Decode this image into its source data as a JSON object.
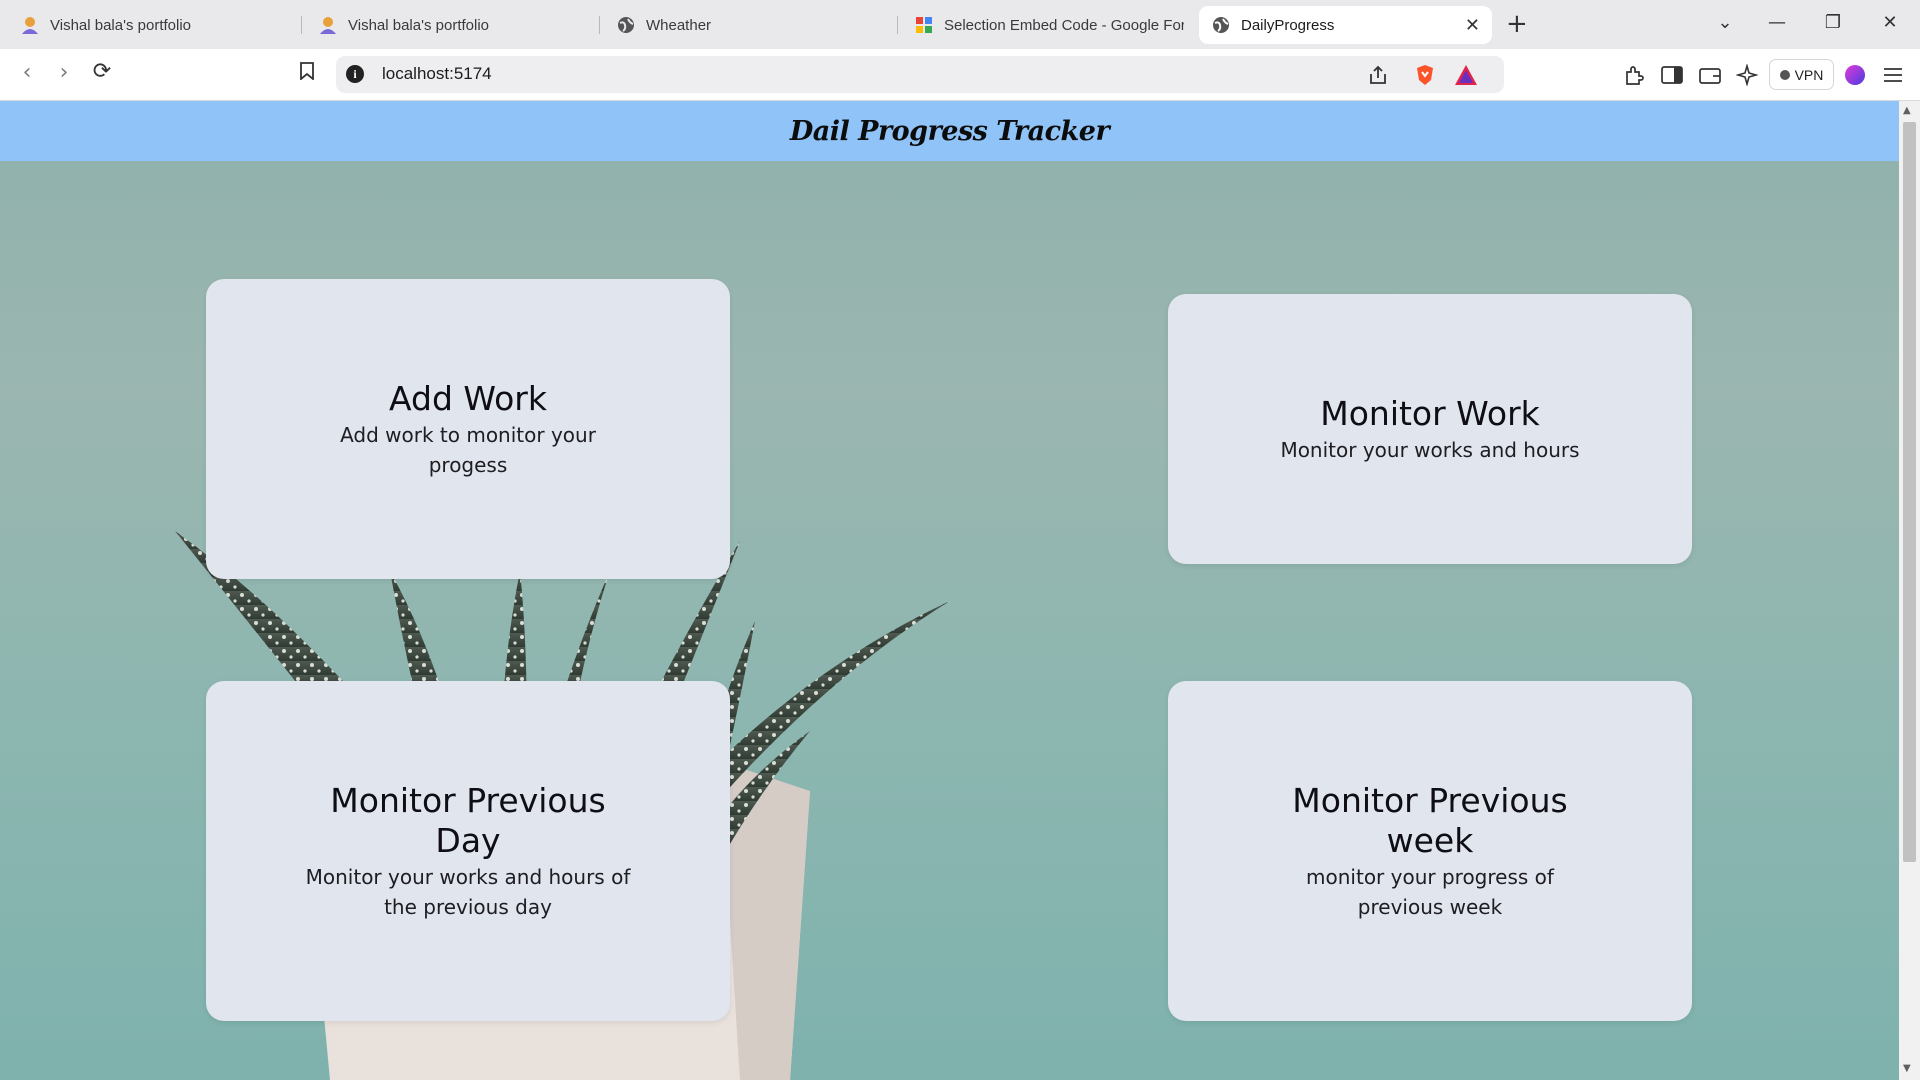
{
  "browser": {
    "tabs": [
      {
        "title": "Vishal bala's portfolio",
        "icon": "avatar-icon"
      },
      {
        "title": "Vishal bala's portfolio",
        "icon": "avatar-icon"
      },
      {
        "title": "Wheather",
        "icon": "globe-icon"
      },
      {
        "title": "Selection Embed Code - Google For",
        "icon": "google-forms-icon"
      },
      {
        "title": "DailyProgress",
        "icon": "globe-icon",
        "active": true
      }
    ],
    "url": "localhost:5174",
    "vpn_label": "VPN"
  },
  "app": {
    "header_title": "Dail Progress Tracker",
    "header_color": "#90c3f7",
    "cards": [
      {
        "title": "Add Work",
        "description": "Add work to monitor your progess"
      },
      {
        "title": "Monitor Work",
        "description": "Monitor your works and hours"
      },
      {
        "title": "Monitor Previous Day",
        "description": "Monitor your works and hours of the previous day"
      },
      {
        "title": "Monitor Previous week",
        "description": "monitor your progress of previous week"
      }
    ]
  }
}
